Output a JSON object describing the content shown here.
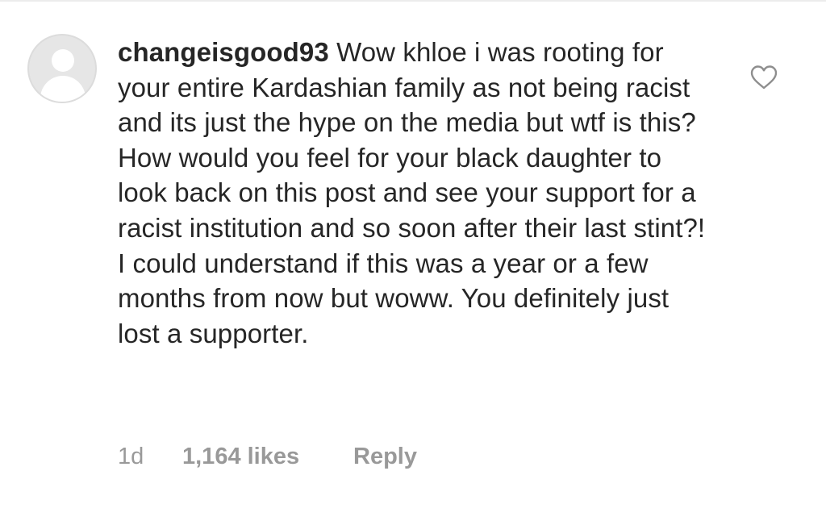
{
  "comment": {
    "username": "changeisgood93",
    "text": "Wow khloe i was rooting for your entire Kardashian family as not being racist and its just the hype on the media but wtf is this? How would you feel for your black daughter to look back on this post and see your support for a racist institution and so soon after their last stint?! I could understand if this was a year or a few months from now but woww. You definitely just lost a supporter.",
    "timestamp": "1d",
    "likes": "1,164 likes",
    "reply_label": "Reply",
    "avatar_icon": "default-user-avatar",
    "like_icon": "heart-outline-icon"
  },
  "colors": {
    "text": "#262626",
    "meta": "#999999",
    "avatar_bg": "#e6e6e6",
    "icon_stroke": "#8e8e8e"
  }
}
